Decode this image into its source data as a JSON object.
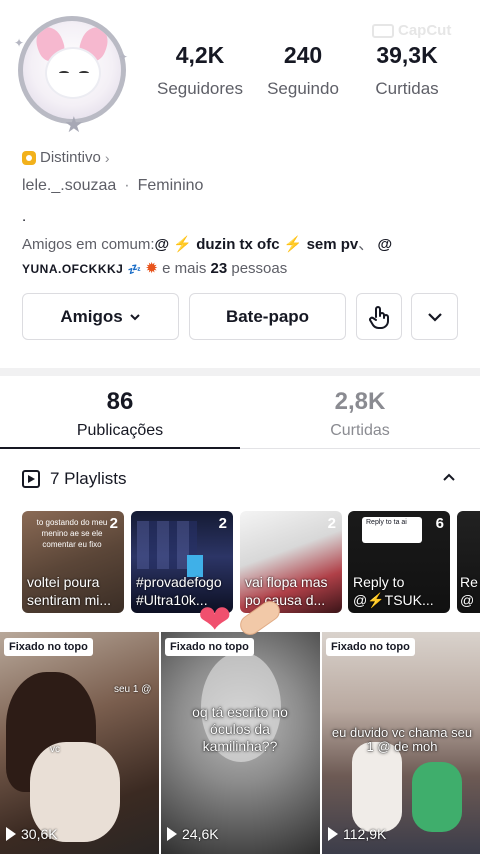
{
  "watermark": "CapCut",
  "profile": {
    "stats": [
      {
        "value": "4,2K",
        "label": "Seguidores"
      },
      {
        "value": "240",
        "label": "Seguindo"
      },
      {
        "value": "39,3K",
        "label": "Curtidas"
      }
    ],
    "badge_label": "Distintivo",
    "username": "lele._.souzaa",
    "gender": "Feminino",
    "bio": ".",
    "mutual": {
      "prefix": "Amigos em comum:",
      "name1": "duzin tx ofc",
      "name2": "sem pv",
      "name3": "YUNA.OFCKKKJ",
      "suffix_text": "e mais",
      "count": "23",
      "suffix_end": "pessoas"
    }
  },
  "actions": {
    "friends_label": "Amigos",
    "chat_label": "Bate-papo"
  },
  "tabs": [
    {
      "value": "86",
      "label": "Publicações"
    },
    {
      "value": "2,8K",
      "label": "Curtidas"
    }
  ],
  "playlists": {
    "header": "7 Playlists",
    "items": [
      {
        "count": "2",
        "title": "voltei poura sentiram mi...",
        "overlay": "to gostando do meu menino ae se ele comentar eu fixo"
      },
      {
        "count": "2",
        "title": "#provadefogo #Ultra10k...",
        "overlay": ""
      },
      {
        "count": "2",
        "title": "vai flopa mas po causa d...",
        "overlay": ""
      },
      {
        "count": "6",
        "title": "Reply to @⚡TSUK...",
        "overlay": "Reply to ta ai"
      },
      {
        "count": "",
        "title": "Re @",
        "overlay": ""
      }
    ]
  },
  "videos": [
    {
      "pin": "Fixado no topo",
      "views": "30,6K",
      "caption": "",
      "small1": "seu 1 @",
      "small2": "vc"
    },
    {
      "pin": "Fixado no topo",
      "views": "24,6K",
      "caption": "oq tá escrito no óculos da kamilinha??",
      "small1": "",
      "small2": ""
    },
    {
      "pin": "Fixado no topo",
      "views": "112,9K",
      "caption": "eu duvido vc chama seu 1 @ de moh",
      "small1": "",
      "small2": ""
    }
  ],
  "colors": {
    "text_primary": "#161823",
    "text_secondary": "#5e5f67",
    "badge": "#f2b11b",
    "heart": "#f0506e"
  }
}
